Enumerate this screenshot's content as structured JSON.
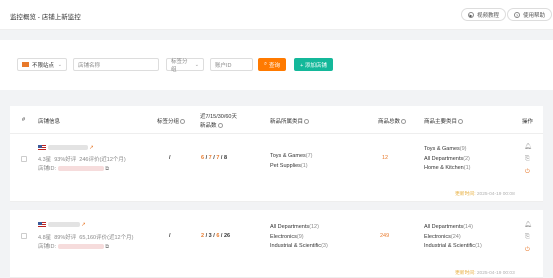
{
  "header": {
    "breadcrumb": "监控概览 - 店铺上新监控",
    "video_btn": "视频教程",
    "help_btn": "使用帮助"
  },
  "filters": {
    "site_select": "不限站点",
    "shop_name_placeholder": "店铺名称",
    "tag_select": "标签分组",
    "seller_id_placeholder": "账户ID",
    "search_btn": "查询",
    "add_btn": "+ 添加店铺"
  },
  "columns": {
    "index": "#",
    "shop_info": "店铺信息",
    "tag_group": "标签分组",
    "new_products_line1": "近7/15/30/60天",
    "new_products_line2": "新品数",
    "new_categories": "新品所属类目",
    "total_products": "商品总数",
    "product_categories": "商品主要类目",
    "actions": "操作"
  },
  "rows": [
    {
      "rating": "4.3星",
      "positive": "93%好评",
      "reviews": "246评价(近12个月)",
      "shop_id_label": "店铺ID:",
      "tag": "/",
      "new7": "6",
      "new15": "7",
      "new30": "7",
      "new60": "8",
      "new_categories": [
        {
          "name": "Toys & Games",
          "count": "(7)"
        },
        {
          "name": "Pet Supplies",
          "count": "(1)"
        }
      ],
      "total": "12",
      "main_categories": [
        {
          "name": "Toys & Games",
          "count": "(9)"
        },
        {
          "name": "All Departments",
          "count": "(2)"
        },
        {
          "name": "Home & Kitchen",
          "count": "(1)"
        }
      ],
      "updated_label": "更新时间:",
      "updated_time": "2025-04-19 00:08"
    },
    {
      "rating": "4.8星",
      "positive": "89%好评",
      "reviews": "65,160评价(近12个月)",
      "shop_id_label": "店铺ID:",
      "tag": "/",
      "new7": "2",
      "new15": "3",
      "new30": "6",
      "new60": "26",
      "new_categories": [
        {
          "name": "All Departments",
          "count": "(12)"
        },
        {
          "name": "Electronics",
          "count": "(9)"
        },
        {
          "name": "Industrial & Scientific",
          "count": "(3)"
        }
      ],
      "total": "249",
      "main_categories": [
        {
          "name": "All Departments",
          "count": "(14)"
        },
        {
          "name": "Electronics",
          "count": "(24)"
        },
        {
          "name": "Industrial & Scientific",
          "count": "(1)"
        }
      ],
      "updated_label": "更新时间:",
      "updated_time": "2025-04-19 00:03"
    }
  ],
  "colors": {
    "accent_orange": "#ff7a00",
    "accent_green": "#14b89a"
  }
}
